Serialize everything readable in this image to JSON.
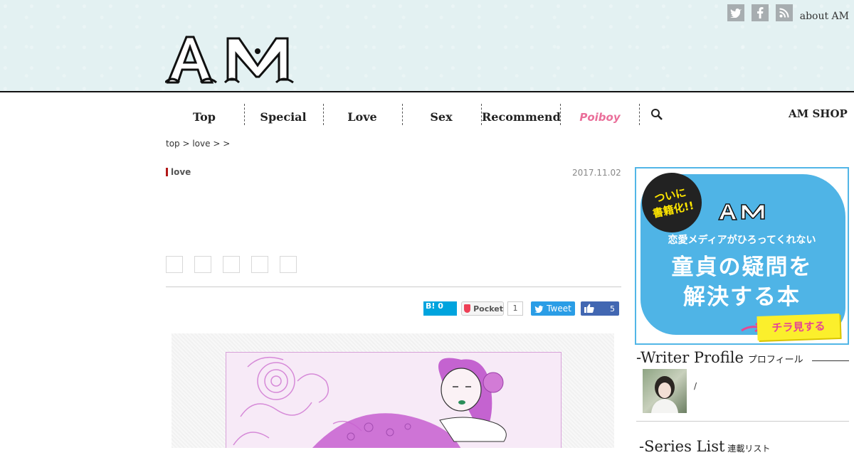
{
  "header": {
    "logo_text": "AM",
    "social_icons": [
      "twitter-icon",
      "facebook-icon",
      "rss-icon"
    ],
    "about_label": "about AM"
  },
  "nav": {
    "items": [
      "Top",
      "Special",
      "Love",
      "Sex",
      "Recommend",
      "Poiboy"
    ],
    "shop_label": "AM SHOP"
  },
  "breadcrumb": "top > love >  >",
  "article": {
    "category": "love",
    "date": "2017.11.02",
    "social": {
      "hatena_label": "B! 0",
      "pocket_label": "Pocket",
      "pocket_count": "1",
      "tweet_label": "Tweet",
      "like_count": "5"
    }
  },
  "sidebar": {
    "banner": {
      "badge_line1": "ついに",
      "badge_line2": "書籍化!!",
      "logo": "AM",
      "subtitle": "恋愛メディアがひろってくれない",
      "title_line1": "童貞の疑問を",
      "title_line2": "解決する本",
      "button_label": "チラ見する"
    },
    "writer_profile": {
      "title": "-Writer Profile",
      "subtitle": "プロフィール",
      "name": "/"
    },
    "series_list": {
      "title": "-Series List",
      "subtitle": "連載リスト"
    }
  },
  "colors": {
    "header_bg": "#e3f1f2",
    "accent_red": "#b21818",
    "poiboy_pink": "#ea6f9a",
    "banner_blue": "#4fb4e6"
  }
}
